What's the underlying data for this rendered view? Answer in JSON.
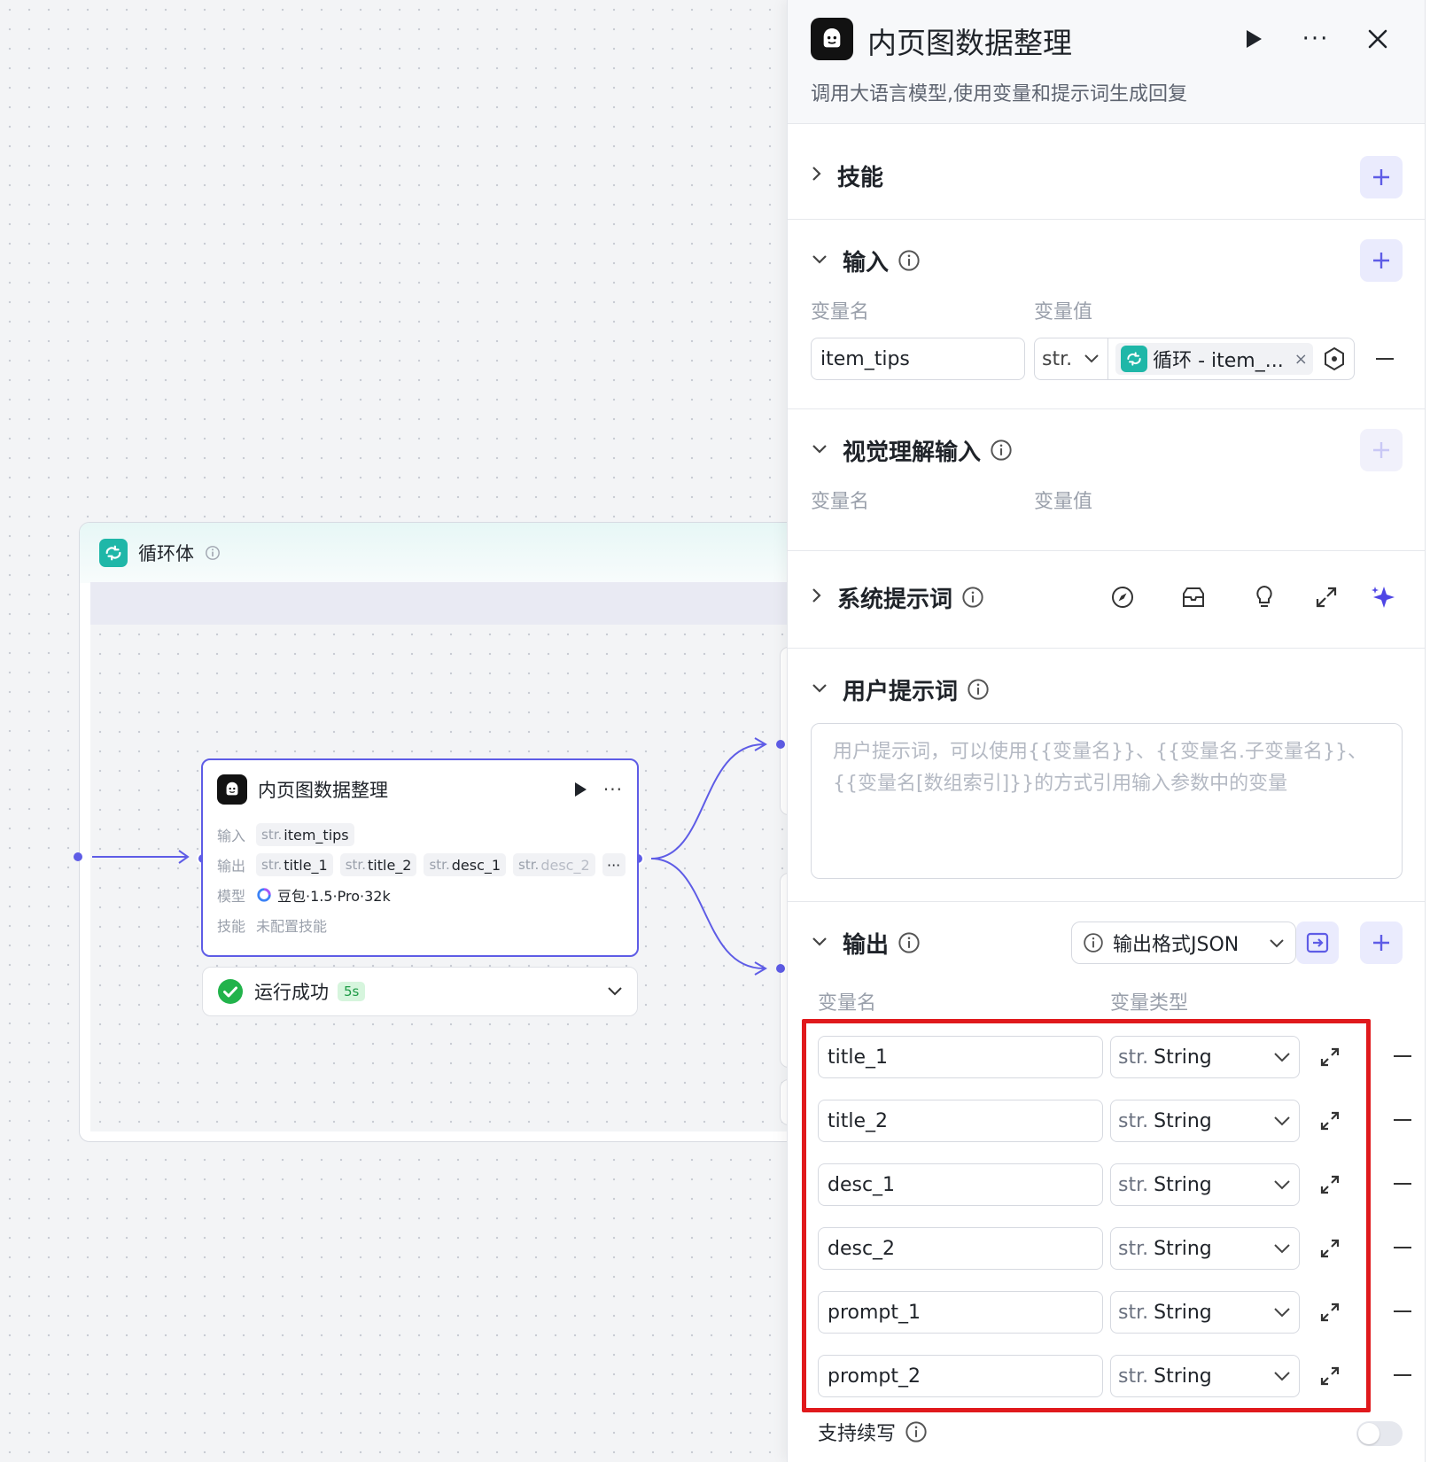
{
  "canvas": {
    "loop": {
      "title": "循环体"
    },
    "node": {
      "title": "内页图数据整理",
      "input_label": "输入",
      "input_var": "item_tips",
      "output_label": "输出",
      "output_vars": [
        "title_1",
        "title_2",
        "desc_1",
        "desc_2"
      ],
      "more_chip": "···",
      "str_prefix": "str.",
      "model_label": "模型",
      "model_name": "豆包·1.5·Pro·32k",
      "skill_label": "技能",
      "skill_value": "未配置技能",
      "more": "···"
    },
    "status": {
      "text": "运行成功",
      "duration": "5s"
    }
  },
  "panel": {
    "title": "内页图数据整理",
    "description": "调用大语言模型,使用变量和提示词生成回复",
    "more": "···",
    "sections": {
      "skills": {
        "title": "技能"
      },
      "input": {
        "title": "输入",
        "col_name": "变量名",
        "col_value": "变量值",
        "row": {
          "name": "item_tips",
          "type": "str.",
          "ref": "循环 - item_...",
          "ref_remove": "×"
        }
      },
      "vision": {
        "title": "视觉理解输入",
        "col_name": "变量名",
        "col_value": "变量值"
      },
      "system_prompt": {
        "title": "系统提示词"
      },
      "user_prompt": {
        "title": "用户提示词",
        "placeholder_line1": "用户提示词，可以使用{{变量名}}、{{变量名.子变量名}}、",
        "placeholder_line2": "{{变量名[数组索引]}}的方式引用输入参数中的变量"
      },
      "output": {
        "title": "输出",
        "format": "输出格式JSON",
        "col_name": "变量名",
        "col_type": "变量类型",
        "type_prefix": "str.",
        "type_label": "String",
        "rows": [
          "title_1",
          "title_2",
          "desc_1",
          "desc_2",
          "prompt_1",
          "prompt_2"
        ],
        "continue_label": "支持续写"
      }
    }
  },
  "colors": {
    "accent": "#5e5ce6",
    "teal": "#1fb7a8",
    "highlight": "#e0191c",
    "success": "#22b34b"
  }
}
